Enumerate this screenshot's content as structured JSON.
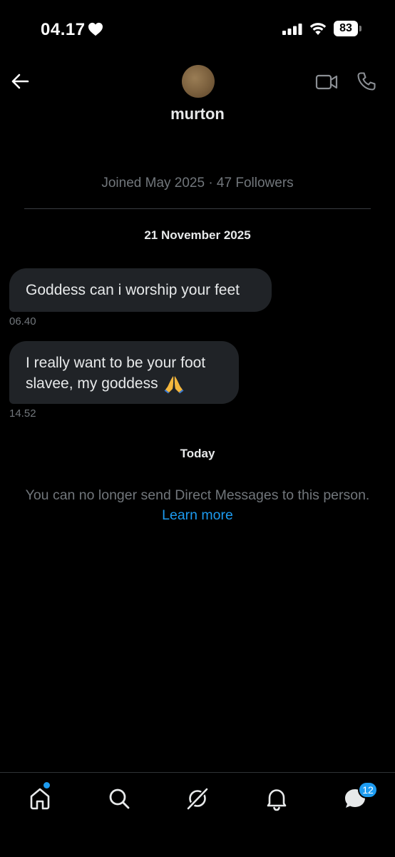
{
  "status_bar": {
    "time": "04.17",
    "battery": "83"
  },
  "header": {
    "username": "murton",
    "profile_meta": "Joined May 2025 · 47 Followers"
  },
  "conversation": {
    "date_separator": "21 November 2025",
    "messages": [
      {
        "text": "Goddess can i worship your feet",
        "time": "06.40"
      },
      {
        "text": "I really want to be your foot slavee, my goddess",
        "emoji": "🙏",
        "time": "14.52"
      }
    ],
    "today_label": "Today",
    "notice": "You can no longer send Direct Messages to this person.",
    "learn_more": "Learn more"
  },
  "bottom_nav": {
    "items": [
      "home-icon",
      "search-icon",
      "grok-icon",
      "bell-icon",
      "messages-icon"
    ],
    "messages_badge": "12"
  },
  "colors": {
    "background": "#000000",
    "bubble": "#202327",
    "accent": "#1d9bf0",
    "muted_text": "#71767b"
  }
}
